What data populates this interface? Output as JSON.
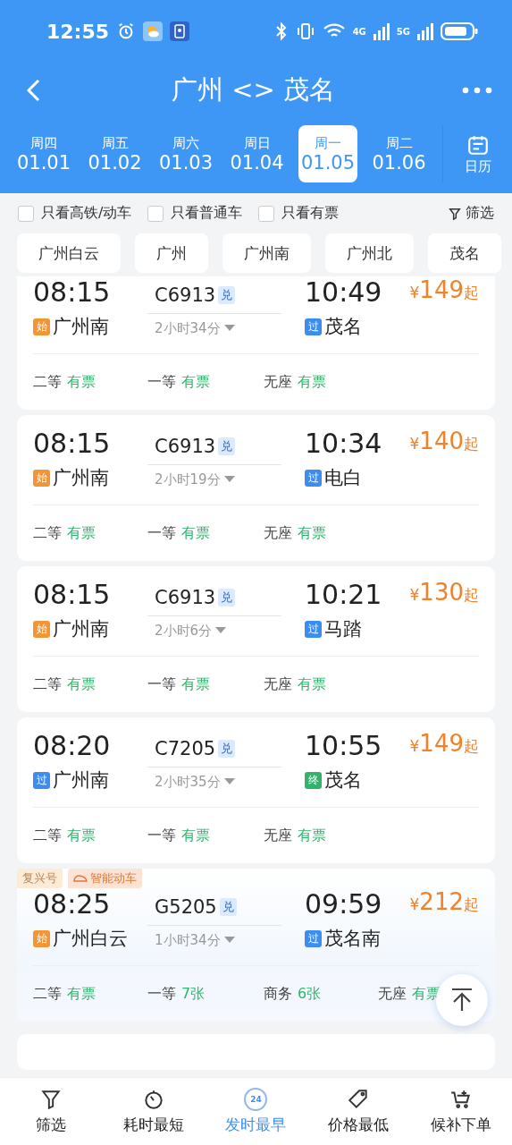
{
  "status_bar": {
    "time": "12:55",
    "net_1": "4G",
    "net_2": "5G"
  },
  "header": {
    "title": "广州 <> 茂名"
  },
  "dates": [
    {
      "weekday": "周四",
      "date": "01.01",
      "selected": false
    },
    {
      "weekday": "周五",
      "date": "01.02",
      "selected": false
    },
    {
      "weekday": "周六",
      "date": "01.03",
      "selected": false
    },
    {
      "weekday": "周日",
      "date": "01.04",
      "selected": false
    },
    {
      "weekday": "周一",
      "date": "01.05",
      "selected": true
    },
    {
      "weekday": "周二",
      "date": "01.06",
      "selected": false
    }
  ],
  "calendar_label": "日历",
  "filters": [
    {
      "label": "只看高铁/动车",
      "checked": false
    },
    {
      "label": "只看普通车",
      "checked": false
    },
    {
      "label": "只看有票",
      "checked": false
    }
  ],
  "filter_button": "筛选",
  "stations": [
    "广州白云",
    "广州",
    "广州南",
    "广州北",
    "茂名"
  ],
  "trains": [
    {
      "depart": "08:15",
      "train": "C6913",
      "mark": "兑",
      "arrive": "10:49",
      "price_symbol": "¥",
      "price": "149",
      "price_suffix": "起",
      "from_tag": {
        "kind": "start",
        "label": "始"
      },
      "from": "广州南",
      "duration": "2小时34分",
      "to_tag": {
        "kind": "pass",
        "label": "过"
      },
      "to": "茂名",
      "highlight": false,
      "seats": [
        {
          "class": "二等",
          "status": "有票"
        },
        {
          "class": "一等",
          "status": "有票"
        },
        {
          "class": "无座",
          "status": "有票"
        }
      ]
    },
    {
      "depart": "08:15",
      "train": "C6913",
      "mark": "兑",
      "arrive": "10:34",
      "price_symbol": "¥",
      "price": "140",
      "price_suffix": "起",
      "from_tag": {
        "kind": "start",
        "label": "始"
      },
      "from": "广州南",
      "duration": "2小时19分",
      "to_tag": {
        "kind": "pass",
        "label": "过"
      },
      "to": "电白",
      "highlight": false,
      "seats": [
        {
          "class": "二等",
          "status": "有票"
        },
        {
          "class": "一等",
          "status": "有票"
        },
        {
          "class": "无座",
          "status": "有票"
        }
      ]
    },
    {
      "depart": "08:15",
      "train": "C6913",
      "mark": "兑",
      "arrive": "10:21",
      "price_symbol": "¥",
      "price": "130",
      "price_suffix": "起",
      "from_tag": {
        "kind": "start",
        "label": "始"
      },
      "from": "广州南",
      "duration": "2小时6分",
      "to_tag": {
        "kind": "pass",
        "label": "过"
      },
      "to": "马踏",
      "highlight": false,
      "seats": [
        {
          "class": "二等",
          "status": "有票"
        },
        {
          "class": "一等",
          "status": "有票"
        },
        {
          "class": "无座",
          "status": "有票"
        }
      ]
    },
    {
      "depart": "08:20",
      "train": "C7205",
      "mark": "兑",
      "arrive": "10:55",
      "price_symbol": "¥",
      "price": "149",
      "price_suffix": "起",
      "from_tag": {
        "kind": "pass",
        "label": "过"
      },
      "from": "广州南",
      "duration": "2小时35分",
      "to_tag": {
        "kind": "end",
        "label": "终"
      },
      "to": "茂名",
      "highlight": false,
      "seats": [
        {
          "class": "二等",
          "status": "有票"
        },
        {
          "class": "一等",
          "status": "有票"
        },
        {
          "class": "无座",
          "status": "有票"
        }
      ]
    },
    {
      "depart": "08:25",
      "train": "G5205",
      "mark": "兑",
      "arrive": "09:59",
      "price_symbol": "¥",
      "price": "212",
      "price_suffix": "起",
      "from_tag": {
        "kind": "start",
        "label": "始"
      },
      "from": "广州白云",
      "duration": "1小时34分",
      "to_tag": {
        "kind": "pass",
        "label": "过"
      },
      "to": "茂名南",
      "highlight": true,
      "badges": [
        {
          "kind": "plain",
          "label": "复兴号"
        },
        {
          "kind": "smart",
          "label": "智能动车"
        }
      ],
      "seats": [
        {
          "class": "二等",
          "status": "有票"
        },
        {
          "class": "一等",
          "status": "7张"
        },
        {
          "class": "商务",
          "status": "6张"
        },
        {
          "class": "无座",
          "status": "有票"
        }
      ]
    }
  ],
  "bottom_nav": [
    {
      "kind": "filter",
      "label": "筛选",
      "selected": false
    },
    {
      "kind": "clock",
      "label": "耗时最短",
      "selected": false
    },
    {
      "kind": "earliest",
      "label": "发时最早",
      "icon_text": "24",
      "selected": true
    },
    {
      "kind": "tag",
      "label": "价格最低",
      "selected": false
    },
    {
      "kind": "cart",
      "label": "候补下单",
      "selected": false
    }
  ]
}
